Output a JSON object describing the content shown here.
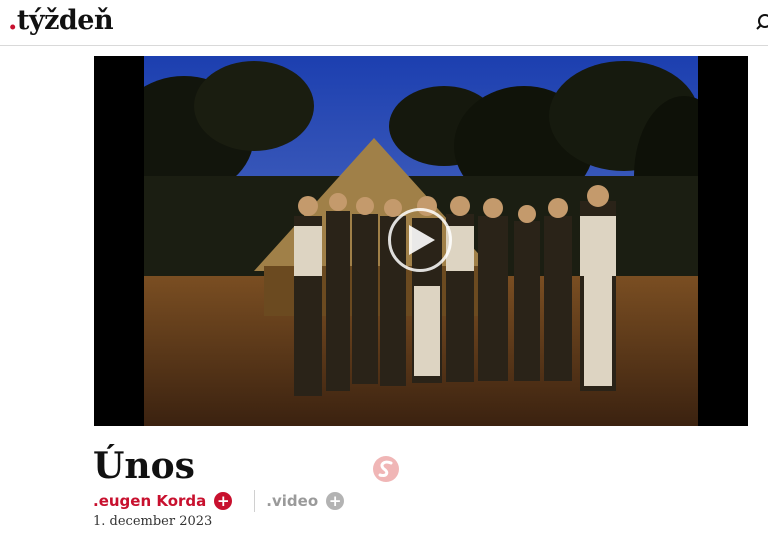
{
  "header": {
    "logo_dot": ".",
    "logo_text": "týždeň",
    "search_icon": "search-icon"
  },
  "video": {
    "thumbnail": "group-photo-thatched-hut-savanna",
    "play_icon": "play-icon"
  },
  "article": {
    "title": "Únos",
    "badge_icon": "s-logo-icon",
    "author": ".eugen Korda",
    "author_follow": "+",
    "category": ".video",
    "category_follow": "+",
    "date": "1. december 2023"
  },
  "colors": {
    "accent": "#c8102e",
    "muted": "#9a9a9a"
  }
}
